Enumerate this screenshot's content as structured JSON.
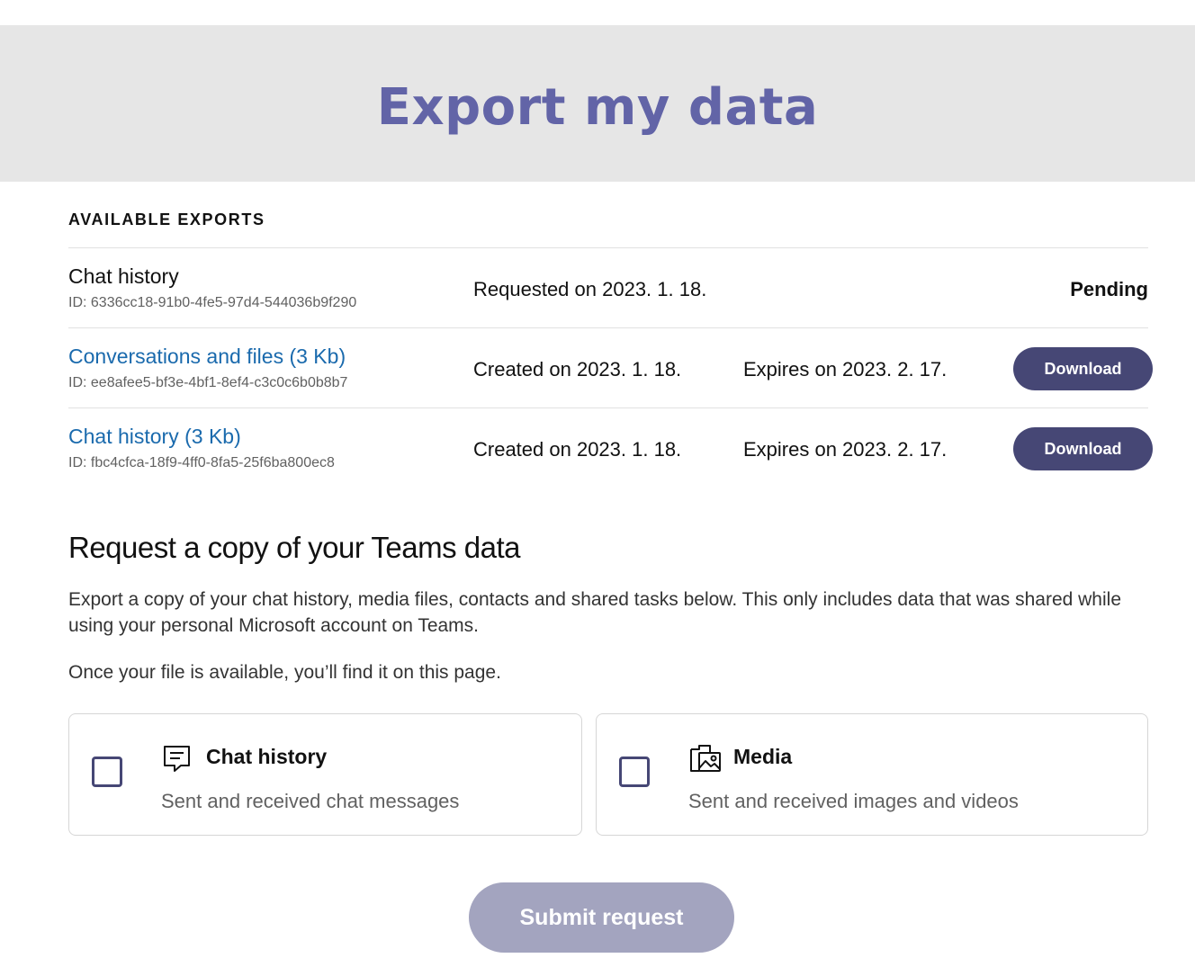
{
  "header": {
    "title": "Export my data"
  },
  "available_exports": {
    "label": "AVAILABLE EXPORTS",
    "rows": [
      {
        "name": "Chat history",
        "id": "ID: 6336cc18-91b0-4fe5-97d4-544036b9f290",
        "date": "Requested on 2023. 1. 18.",
        "status": "Pending"
      },
      {
        "name": "Conversations and files (3 Kb)",
        "id": "ID: ee8afee5-bf3e-4bf1-8ef4-c3c0c6b0b8b7",
        "date": "Created on 2023. 1. 18.",
        "expires": "Expires on 2023. 2. 17.",
        "action": "Download"
      },
      {
        "name": "Chat history (3 Kb)",
        "id": "ID: fbc4cfca-18f9-4ff0-8fa5-25f6ba800ec8",
        "date": "Created on 2023. 1. 18.",
        "expires": "Expires on 2023. 2. 17.",
        "action": "Download"
      }
    ]
  },
  "request": {
    "title": "Request a copy of your Teams data",
    "description": "Export a copy of your chat history, media files, contacts and shared tasks below. This only includes data that was shared while using your personal Microsoft account on Teams.",
    "note": "Once your file is available, you’ll find it on this page.",
    "options": [
      {
        "title": "Chat history",
        "subtitle": "Sent and received chat messages",
        "icon": "chat-icon",
        "checked": false
      },
      {
        "title": "Media",
        "subtitle": "Sent and received images and videos",
        "icon": "media-icon",
        "checked": false
      }
    ],
    "submit_label": "Submit request"
  },
  "colors": {
    "accent": "#6264a7",
    "button": "#464775",
    "button_disabled": "#a3a4bf",
    "link": "#1a6aad",
    "hero_bg": "#e6e6e6"
  }
}
